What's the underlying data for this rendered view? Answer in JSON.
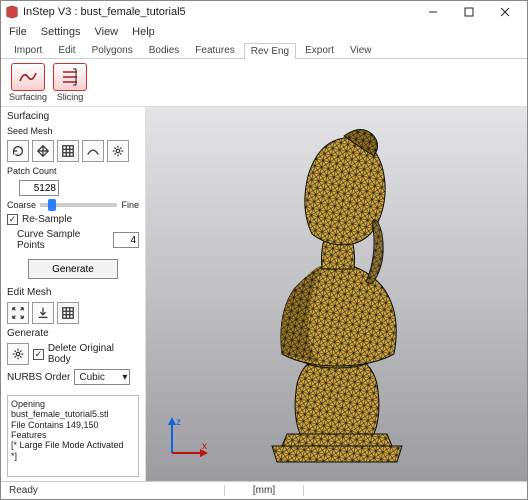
{
  "window": {
    "title": "InStep V3 : bust_female_tutorial5",
    "min_tip": "Minimize",
    "max_tip": "Maximize",
    "close_tip": "Close"
  },
  "menu": {
    "file": "File",
    "settings": "Settings",
    "view": "View",
    "help": "Help"
  },
  "tabs": [
    "Import",
    "Edit",
    "Polygons",
    "Bodies",
    "Features",
    "Rev Eng",
    "Export",
    "View"
  ],
  "active_tab": "Rev Eng",
  "ribbon": {
    "surfacing": "Surfacing",
    "slicing": "Slicing"
  },
  "panel": {
    "group_surfacing": "Surfacing",
    "seed_mesh": "Seed Mesh",
    "patch_count_lbl": "Patch Count",
    "patch_count_val": "5128",
    "coarse": "Coarse",
    "fine": "Fine",
    "resample_lbl": "Re-Sample",
    "resample_checked": "✓",
    "curve_pts_lbl": "Curve Sample Points",
    "curve_pts_val": "4",
    "generate": "Generate",
    "edit_mesh": "Edit Mesh",
    "generate_grp": "Generate",
    "delete_orig_lbl": "Delete Original Body",
    "delete_orig_checked": "✓",
    "nurbs_lbl": "NURBS Order",
    "nurbs_val": "Cubic"
  },
  "log": {
    "l1": "Opening",
    "l2": "bust_female_tutorial5.stl",
    "l3": "File Contains 149,150 Features",
    "l4": "[* Large File Mode Activated",
    "l5": "*]"
  },
  "status": {
    "ready": "Ready",
    "units": "[mm]"
  },
  "axis": {
    "z": "z",
    "x": "x"
  },
  "colors": {
    "mesh_fill": "#d7a93a",
    "mesh_stroke": "#1a1a1a"
  }
}
